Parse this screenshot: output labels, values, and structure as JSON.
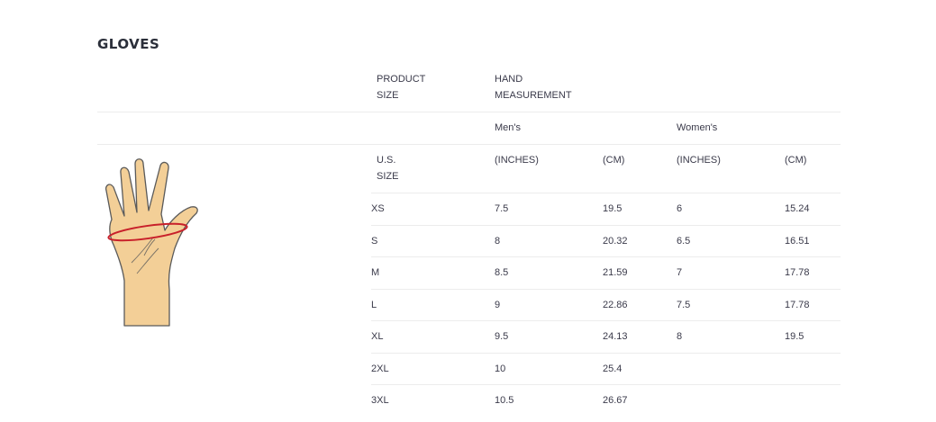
{
  "title": "GLOVES",
  "header": {
    "product_size": [
      "PRODUCT",
      "SIZE"
    ],
    "hand_measurement": [
      "HAND",
      "MEASUREMENT"
    ],
    "mens": "Men's",
    "womens": "Women's",
    "us_size": [
      "U.S.",
      "SIZE"
    ],
    "mens_inches": "(INCHES)",
    "mens_cm": "(CM)",
    "womens_inches": "(INCHES)",
    "womens_cm": "(CM)"
  },
  "rows": [
    {
      "size": "XS",
      "mens_in": "7.5",
      "mens_cm": "19.5",
      "womens_in": "6",
      "womens_cm": "15.24"
    },
    {
      "size": "S",
      "mens_in": "8",
      "mens_cm": "20.32",
      "womens_in": "6.5",
      "womens_cm": "16.51"
    },
    {
      "size": "M",
      "mens_in": "8.5",
      "mens_cm": "21.59",
      "womens_in": "7",
      "womens_cm": "17.78"
    },
    {
      "size": "L",
      "mens_in": "9",
      "mens_cm": "22.86",
      "womens_in": "7.5",
      "womens_cm": "17.78"
    },
    {
      "size": "XL",
      "mens_in": "9.5",
      "mens_cm": "24.13",
      "womens_in": "8",
      "womens_cm": "19.5"
    },
    {
      "size": "2XL",
      "mens_in": "10",
      "mens_cm": "25.4",
      "womens_in": "",
      "womens_cm": ""
    },
    {
      "size": "3XL",
      "mens_in": "10.5",
      "mens_cm": "26.67",
      "womens_in": "",
      "womens_cm": ""
    }
  ],
  "colors": {
    "skin": "#f3cf97",
    "outline": "#5a5a5a",
    "measure_line": "#c8202a"
  },
  "icon": "hand-measurement-icon"
}
